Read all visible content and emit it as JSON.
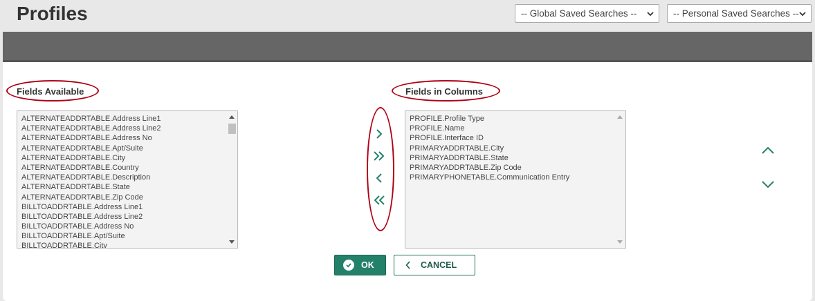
{
  "header": {
    "title": "Profiles",
    "global_search_selected": "-- Global Saved Searches --",
    "personal_search_selected": "-- Personal Saved Searches --"
  },
  "available": {
    "label": "Fields Available",
    "items": [
      "ALTERNATEADDRTABLE.Address Line1",
      "ALTERNATEADDRTABLE.Address Line2",
      "ALTERNATEADDRTABLE.Address No",
      "ALTERNATEADDRTABLE.Apt/Suite",
      "ALTERNATEADDRTABLE.City",
      "ALTERNATEADDRTABLE.Country",
      "ALTERNATEADDRTABLE.Description",
      "ALTERNATEADDRTABLE.State",
      "ALTERNATEADDRTABLE.Zip Code",
      "BILLTOADDRTABLE.Address Line1",
      "BILLTOADDRTABLE.Address Line2",
      "BILLTOADDRTABLE.Address No",
      "BILLTOADDRTABLE.Apt/Suite",
      "BILLTOADDRTABLE.City"
    ]
  },
  "columns": {
    "label": "Fields in Columns",
    "items": [
      "PROFILE.Profile Type",
      "PROFILE.Name",
      "PROFILE.Interface ID",
      "PRIMARYADDRTABLE.City",
      "PRIMARYADDRTABLE.State",
      "PRIMARYADDRTABLE.Zip Code",
      "PRIMARYPHONETABLE.Communication Entry"
    ]
  },
  "buttons": {
    "ok": "OK",
    "cancel": "CANCEL"
  },
  "colors": {
    "accent": "#23816a",
    "annotation": "#b00014",
    "header_bar": "#666666"
  },
  "icons": {
    "move_right": "chevron-right-icon",
    "move_all_right": "double-chevron-right-icon",
    "move_left": "chevron-left-icon",
    "move_all_left": "double-chevron-left-icon",
    "order_up": "chevron-up-icon",
    "order_down": "chevron-down-icon"
  }
}
